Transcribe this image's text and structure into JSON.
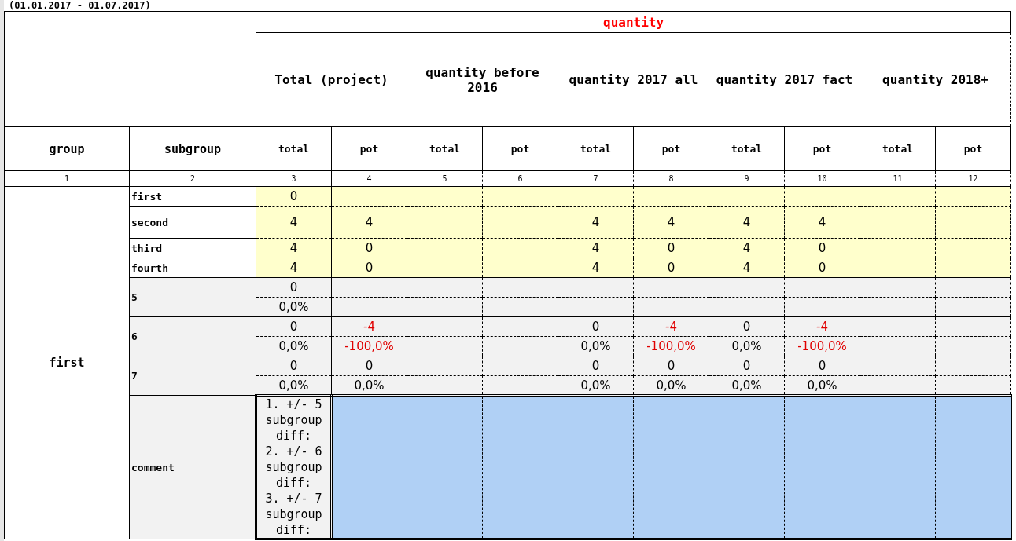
{
  "period": "(01.01.2017 - 01.07.2017)",
  "header": {
    "title": "quantity",
    "group_label": "group",
    "subgroup_label": "subgroup",
    "groups": [
      "Total (project)",
      "quantity before 2016",
      "quantity 2017 all",
      "quantity 2017 fact",
      "quantity 2018+"
    ],
    "subcolumns": [
      "total",
      "pot",
      "total",
      "pot",
      "total",
      "pot",
      "total",
      "pot",
      "total",
      "pot"
    ],
    "numbers": [
      "1",
      "2",
      "3",
      "4",
      "5",
      "6",
      "7",
      "8",
      "9",
      "10",
      "11",
      "12"
    ]
  },
  "group": "first",
  "rows": [
    {
      "kind": "single",
      "label": "first",
      "cells": {
        "c3": {
          "t": "0",
          "neg": false
        }
      }
    },
    {
      "kind": "single",
      "label": "second",
      "cells": {
        "c3": {
          "t": "4",
          "neg": false
        },
        "c4": {
          "t": "4",
          "neg": false
        },
        "c7": {
          "t": "4",
          "neg": false
        },
        "c8": {
          "t": "4",
          "neg": false
        },
        "c9": {
          "t": "4",
          "neg": false
        },
        "c10": {
          "t": "4",
          "neg": false
        }
      }
    },
    {
      "kind": "single",
      "label": "third",
      "cells": {
        "c3": {
          "t": "4",
          "neg": false
        },
        "c4": {
          "t": "0",
          "neg": false
        },
        "c7": {
          "t": "4",
          "neg": false
        },
        "c8": {
          "t": "0",
          "neg": false
        },
        "c9": {
          "t": "4",
          "neg": false
        },
        "c10": {
          "t": "0",
          "neg": false
        }
      }
    },
    {
      "kind": "single",
      "label": "fourth",
      "cells": {
        "c3": {
          "t": "4",
          "neg": false
        },
        "c4": {
          "t": "0",
          "neg": false
        },
        "c7": {
          "t": "4",
          "neg": false
        },
        "c8": {
          "t": "0",
          "neg": false
        },
        "c9": {
          "t": "4",
          "neg": false
        },
        "c10": {
          "t": "0",
          "neg": false
        }
      }
    },
    {
      "kind": "pair",
      "label": "5",
      "lines": [
        {
          "c3": {
            "t": "0",
            "neg": false
          }
        },
        {
          "c3": {
            "t": "0,0%",
            "neg": false
          }
        }
      ]
    },
    {
      "kind": "pair",
      "label": "6",
      "lines": [
        {
          "c3": {
            "t": "0",
            "neg": false
          },
          "c4": {
            "t": "-4",
            "neg": true
          },
          "c7": {
            "t": "0",
            "neg": false
          },
          "c8": {
            "t": "-4",
            "neg": true
          },
          "c9": {
            "t": "0",
            "neg": false
          },
          "c10": {
            "t": "-4",
            "neg": true
          }
        },
        {
          "c3": {
            "t": "0,0%",
            "neg": false
          },
          "c4": {
            "t": "-100,0%",
            "neg": true
          },
          "c7": {
            "t": "0,0%",
            "neg": false
          },
          "c8": {
            "t": "-100,0%",
            "neg": true
          },
          "c9": {
            "t": "0,0%",
            "neg": false
          },
          "c10": {
            "t": "-100,0%",
            "neg": true
          }
        }
      ]
    },
    {
      "kind": "pair",
      "label": "7",
      "lines": [
        {
          "c3": {
            "t": "0",
            "neg": false
          },
          "c4": {
            "t": "0",
            "neg": false
          },
          "c7": {
            "t": "0",
            "neg": false
          },
          "c8": {
            "t": "0",
            "neg": false
          },
          "c9": {
            "t": "0",
            "neg": false
          },
          "c10": {
            "t": "0",
            "neg": false
          }
        },
        {
          "c3": {
            "t": "0,0%",
            "neg": false
          },
          "c4": {
            "t": "0,0%",
            "neg": false
          },
          "c7": {
            "t": "0,0%",
            "neg": false
          },
          "c8": {
            "t": "0,0%",
            "neg": false
          },
          "c9": {
            "t": "0,0%",
            "neg": false
          },
          "c10": {
            "t": "0,0%",
            "neg": false
          }
        }
      ]
    },
    {
      "kind": "comment",
      "label": "comment",
      "text": "1. +/- 5 subgroup diff:\n2. +/- 6 subgroup diff:\n3. +/- 7 subgroup diff:"
    }
  ]
}
